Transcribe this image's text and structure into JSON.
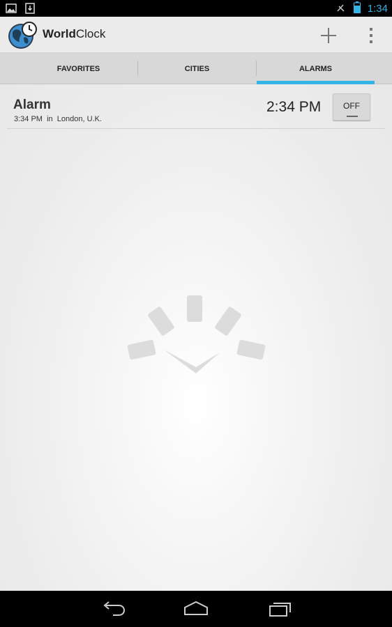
{
  "status_bar": {
    "time": "1:34",
    "left_icons": [
      "gallery-notification-icon",
      "download-notification-icon"
    ],
    "right_icons": [
      "no-signal-icon",
      "battery-icon"
    ],
    "accent_color": "#33b5e5"
  },
  "app_bar": {
    "title_bold": "World",
    "title_regular": "Clock",
    "actions": [
      "add-icon",
      "overflow-menu-icon"
    ]
  },
  "tabs": [
    {
      "label": "FAVORITES",
      "active": false
    },
    {
      "label": "CITIES",
      "active": false
    },
    {
      "label": "ALARMS",
      "active": true
    }
  ],
  "alarms": [
    {
      "name": "Alarm",
      "detail": "3:34 PM  in  London, U.K.",
      "time": "2:34 PM",
      "toggle_label": "OFF",
      "enabled": false
    }
  ],
  "nav_bar": {
    "buttons": [
      "back-icon",
      "home-icon",
      "recent-apps-icon"
    ]
  }
}
